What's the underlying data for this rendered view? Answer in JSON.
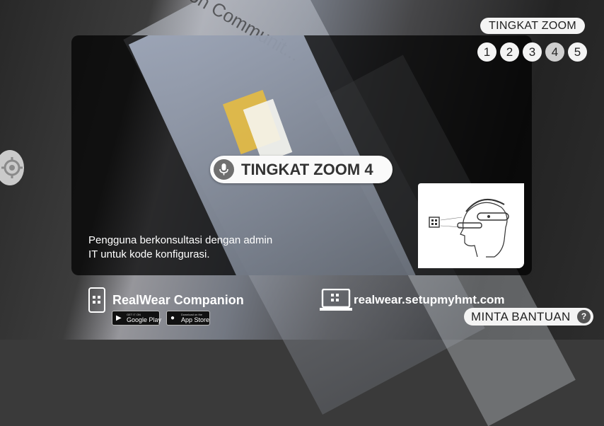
{
  "zoom": {
    "title": "TINGKAT ZOOM",
    "levels": [
      "1",
      "2",
      "3",
      "4",
      "5"
    ],
    "active_level": "4"
  },
  "toast": {
    "text": "TINGKAT ZOOM 4",
    "icon": "microphone-icon"
  },
  "background_text": "...ation Communit...",
  "instructions": {
    "line1": "Pengguna berkonsultasi dengan admin",
    "line2": "IT untuk kode konfigurasi."
  },
  "companion": {
    "title": "RealWear Companion",
    "google_play_small": "GET IT ON",
    "google_play": "Google Play",
    "app_store_small": "Download on the",
    "app_store": "App Store"
  },
  "setup": {
    "url": "realwear.setupmyhmt.com"
  },
  "help": {
    "label": "MINTA BANTUAN",
    "icon_glyph": "?"
  },
  "colors": {
    "pill_bg": "#f4f4f4",
    "active_level_bg": "#cfcfcf",
    "text_dark": "#222222"
  }
}
